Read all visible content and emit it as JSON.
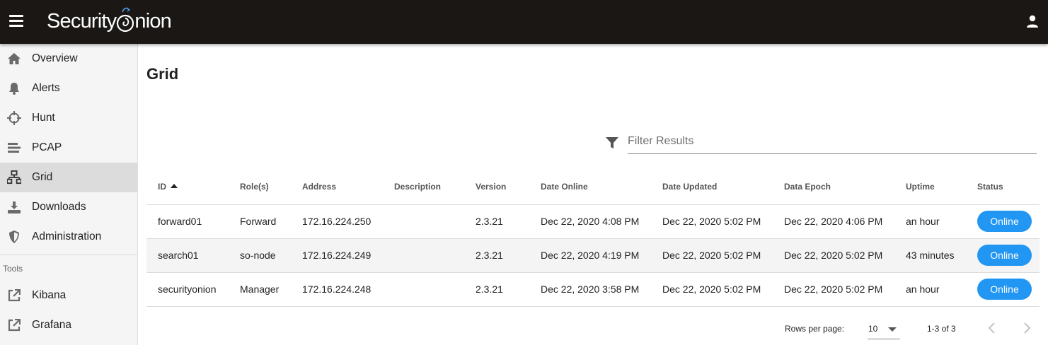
{
  "header": {
    "logo_text_left": "Security",
    "logo_text_right": "nion",
    "logo_o_letter": "O"
  },
  "sidebar": {
    "items": [
      {
        "label": "Overview",
        "icon": "home-icon"
      },
      {
        "label": "Alerts",
        "icon": "bell-icon"
      },
      {
        "label": "Hunt",
        "icon": "crosshairs-icon"
      },
      {
        "label": "PCAP",
        "icon": "stream-icon"
      },
      {
        "label": "Grid",
        "icon": "network-icon",
        "active": true
      },
      {
        "label": "Downloads",
        "icon": "download-icon"
      },
      {
        "label": "Administration",
        "icon": "shield-icon"
      }
    ],
    "tools_header": "Tools",
    "tools": [
      {
        "label": "Kibana",
        "icon": "external-link-icon"
      },
      {
        "label": "Grafana",
        "icon": "external-link-icon"
      }
    ]
  },
  "main": {
    "title": "Grid",
    "filter": {
      "placeholder": "Filter Results",
      "value": ""
    },
    "table": {
      "columns": [
        "ID",
        "Role(s)",
        "Address",
        "Description",
        "Version",
        "Date Online",
        "Date Updated",
        "Data Epoch",
        "Uptime",
        "Status"
      ],
      "sort_column": "ID",
      "sort_direction": "ascending",
      "rows": [
        {
          "id": "forward01",
          "role": "Forward",
          "address": "172.16.224.250",
          "description": "",
          "version": "2.3.21",
          "date_online": "Dec 22, 2020 4:08 PM",
          "date_updated": "Dec 22, 2020 5:02 PM",
          "data_epoch": "Dec 22, 2020 4:06 PM",
          "uptime": "an hour",
          "status": "Online"
        },
        {
          "id": "search01",
          "role": "so-node",
          "address": "172.16.224.249",
          "description": "",
          "version": "2.3.21",
          "date_online": "Dec 22, 2020 4:19 PM",
          "date_updated": "Dec 22, 2020 5:02 PM",
          "data_epoch": "Dec 22, 2020 5:02 PM",
          "uptime": "43 minutes",
          "status": "Online"
        },
        {
          "id": "securityonion",
          "role": "Manager",
          "address": "172.16.224.248",
          "description": "",
          "version": "2.3.21",
          "date_online": "Dec 22, 2020 3:58 PM",
          "date_updated": "Dec 22, 2020 5:02 PM",
          "data_epoch": "Dec 22, 2020 5:02 PM",
          "uptime": "an hour",
          "status": "Online"
        }
      ]
    },
    "footer": {
      "rows_per_page_label": "Rows per page:",
      "rows_per_page_value": "10",
      "range_text": "1-3 of 3"
    }
  },
  "colors": {
    "topbar": "#1a1715",
    "status_online": "#2196f3",
    "active_nav": "#dcdcdc",
    "logo_accent": "#4a90d9"
  }
}
